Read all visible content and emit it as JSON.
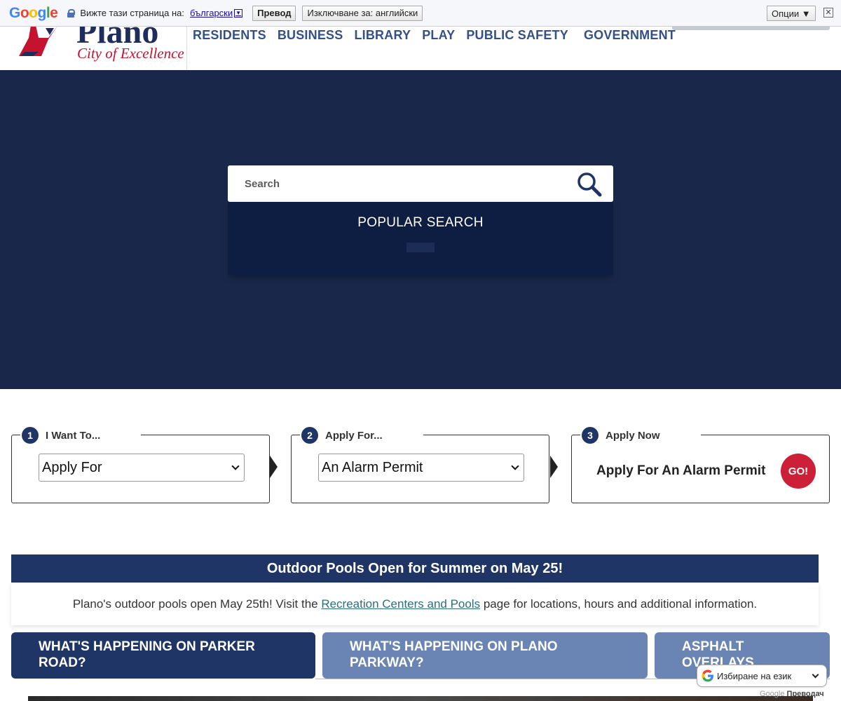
{
  "translate_bar": {
    "logo": "Google",
    "prompt": "Вижте тази страница на:",
    "language": "български",
    "translate_label": "Превод",
    "exclude_label": "Изключване за: английски",
    "options_label": "Опции ▼",
    "close_glyph": "✕"
  },
  "header": {
    "logo_name": "Plano",
    "logo_tagline": "City of Excellence",
    "nav": [
      "RESIDENTS",
      "BUSINESS",
      "LIBRARY",
      "PLAY",
      "PUBLIC SAFETY",
      "GOVERNMENT"
    ]
  },
  "hero": {
    "search_placeholder": "Search",
    "popular_title": "POPULAR SEARCH"
  },
  "steps": [
    {
      "number": "1",
      "label": "I Want To...",
      "selected": "Apply For"
    },
    {
      "number": "2",
      "label": "Apply For...",
      "selected": "An Alarm Permit"
    },
    {
      "number": "3",
      "label": "Apply Now",
      "result": "Apply For An Alarm Permit",
      "go_label": "GO!"
    }
  ],
  "alert": {
    "title": "Outdoor Pools Open for Summer on May 25!",
    "body_before": "Plano's outdoor pools open May 25th! Visit the ",
    "link_text": "Recreation Centers and Pools",
    "body_after": " page for locations, hours and additional information."
  },
  "cards": [
    {
      "line1": "WHAT'S HAPPENING ON PARKER",
      "line2": "ROAD?"
    },
    {
      "line1": "WHAT'S HAPPENING ON PLANO",
      "line2": "PARKWAY?"
    },
    {
      "line1": "ASPHALT",
      "line2": "OVERLAYS"
    }
  ],
  "language_widget": {
    "label": "Избиране на език",
    "powered_brand": "Google",
    "powered_text": "Преводач"
  },
  "colors": {
    "navy": "#1f3566",
    "hero_bg": "#19284a",
    "card_light": "#6a85b4",
    "go_red": "#cc1f38",
    "link_teal": "#2b6f7a"
  }
}
